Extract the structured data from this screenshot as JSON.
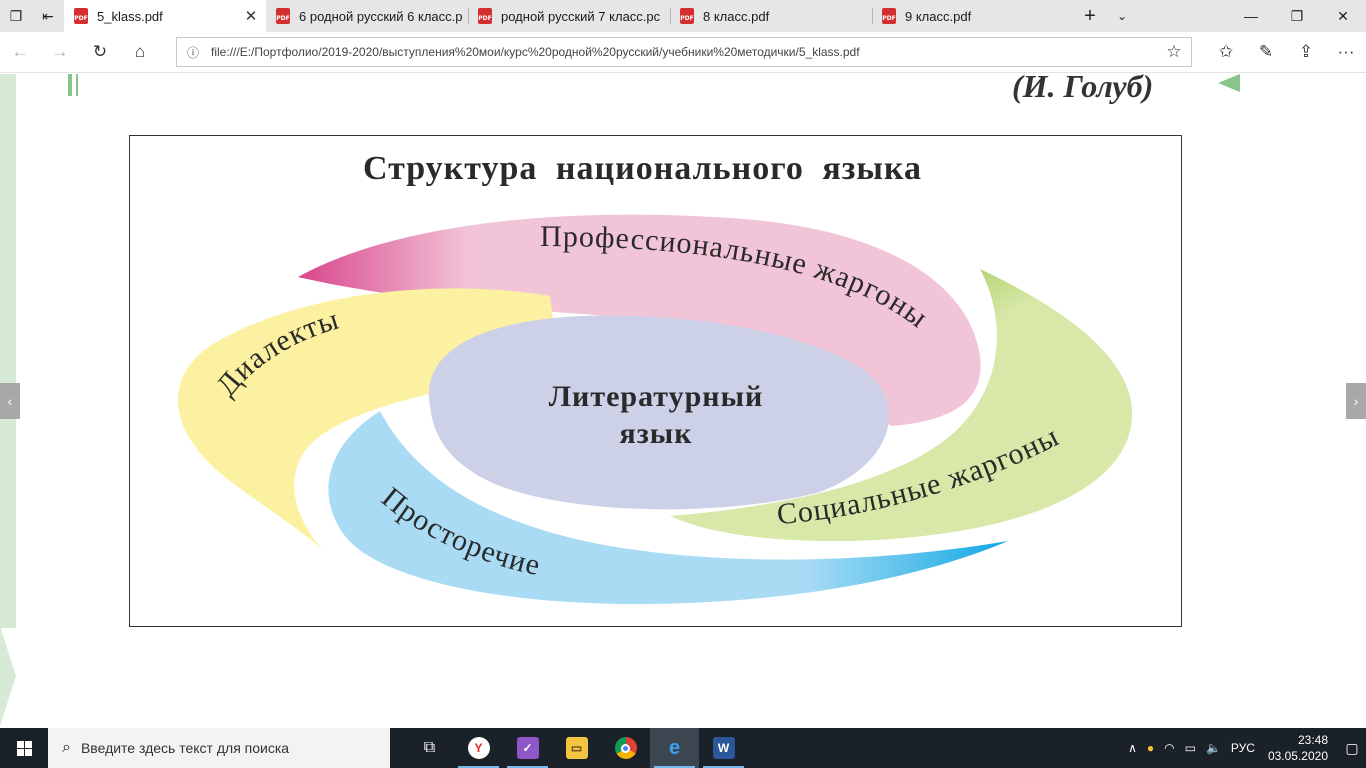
{
  "browser": {
    "tabs": [
      {
        "title": "5_klass.pdf",
        "active": true
      },
      {
        "title": "6 родной русский 6 класс.р",
        "active": false
      },
      {
        "title": "родной русский 7 класс.pc",
        "active": false
      },
      {
        "title": "8 класс.pdf",
        "active": false
      },
      {
        "title": "9 класс.pdf",
        "active": false
      }
    ],
    "url": "file:///E:/Портфолио/2019-2020/выступления%20мои/курс%20родной%20русский/учебники%20методички/5_klass.pdf"
  },
  "page": {
    "author": "(И. Голуб)",
    "figure": {
      "title": "Структура  национального  языка",
      "center": [
        "Литературный",
        "язык"
      ],
      "petals": {
        "professional": "Профессиональные жаргоны",
        "dialects": "Диалекты",
        "social": "Социальные жаргоны",
        "vernacular": "Просторечие"
      },
      "colors": {
        "professional": "#f2c4d8",
        "dialects": "#fbf1a0",
        "social": "#d7e8a8",
        "vernacular": "#a9dcf4",
        "center": "#cdd1e8"
      }
    }
  },
  "taskbar": {
    "search_placeholder": "Введите здесь текст для поиска",
    "apps": [
      "task-view-icon",
      "yandex-browser-icon",
      "app-icon",
      "file-explorer-icon",
      "chrome-icon",
      "edge-icon",
      "word-icon"
    ],
    "language": "РУС",
    "time": "23:48",
    "date": "03.05.2020"
  }
}
